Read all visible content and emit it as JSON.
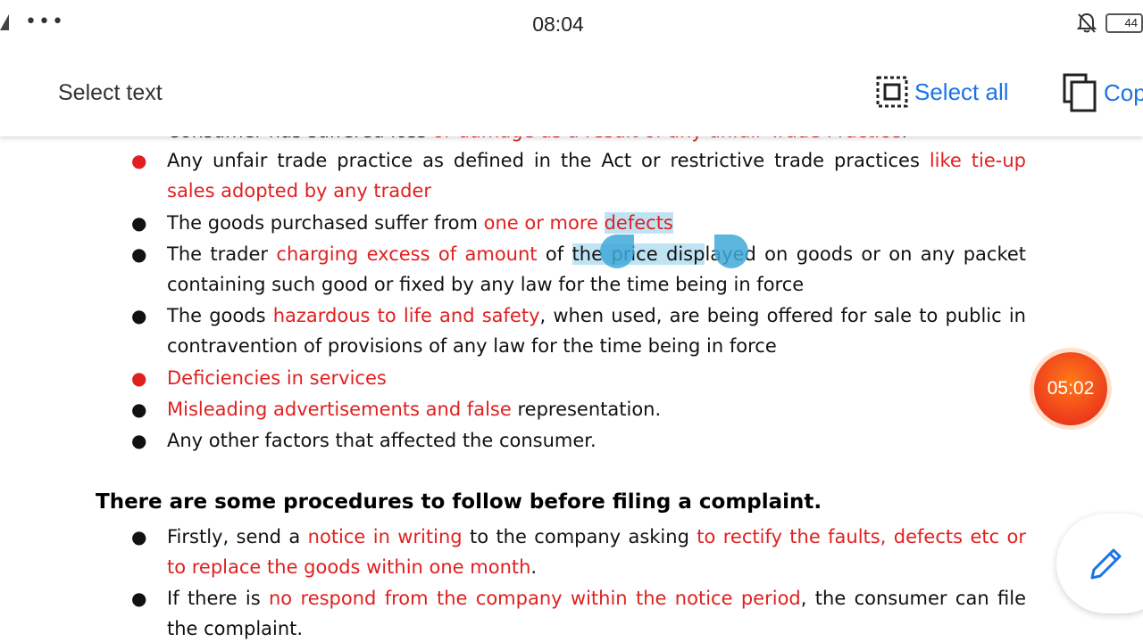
{
  "status_bar": {
    "time": "08:04",
    "battery": "44",
    "icons": [
      "signal-icon",
      "more-dots-icon",
      "mute-bell-icon",
      "battery-icon"
    ]
  },
  "toolbar": {
    "title": "Select text",
    "select_all_label": "Select all",
    "copy_label": "Copy"
  },
  "doc": {
    "partial_line": {
      "black": "Consumer has suffered loss ",
      "red": "or damage as a result of any unfair Trade Practice",
      "tail": "."
    },
    "items": [
      {
        "id": "unfair",
        "p1": "Any unfair trade practice as defined in the Act or restrictive trade practices ",
        "r1": "like tie-up sales adopted by any trader"
      },
      {
        "id": "defects",
        "p1": "The goods purchased suffer from ",
        "r1": "one or more ",
        "sel": "defects"
      },
      {
        "id": "excess",
        "p1": "The trader ",
        "r1": "charging excess of amount",
        "p2": " of ",
        "sel1": "the price disp",
        "p3": "layed on goods or on any packet containing such good or fixed by any law for the time being in force"
      },
      {
        "id": "hazard",
        "p1": "The goods ",
        "r1": "hazardous to life and safety",
        "p2": ", when used, are being offered for sale to public in contravention of provisions of any law for the time being in force"
      },
      {
        "id": "deficiency",
        "r1": "Deficiencies in services"
      },
      {
        "id": "misleading",
        "r1": "Misleading advertisements and false",
        "p2": " representation."
      },
      {
        "id": "other",
        "p1": "Any other factors that affected the consumer."
      }
    ],
    "heading": "There are some procedures to follow before filing a complaint.",
    "procedures": [
      {
        "p1": "Firstly, send a ",
        "r1": "notice in writing",
        "p2": " to the company asking ",
        "r2": "to rectify the faults, defects etc or to replace the goods within one month",
        "p3": "."
      },
      {
        "p1": "If there is ",
        "r1": "no respond from the company within the notice period",
        "p2": ", the consumer can file the complaint."
      }
    ],
    "bullet_char": "●"
  },
  "timer": {
    "value": "05:02"
  },
  "colors": {
    "accent": "#1a73e8",
    "red_text": "#e02020",
    "selection": "#bfe3f3",
    "timer": "#ee3b1b"
  }
}
